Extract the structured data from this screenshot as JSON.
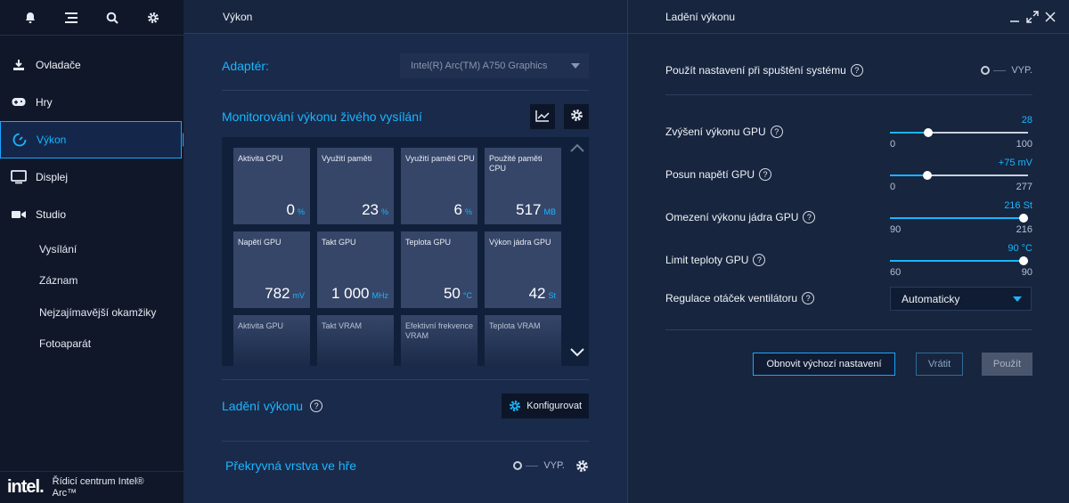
{
  "sidebar": {
    "top_icons": [
      "bell-icon",
      "menu-icon",
      "search-icon",
      "gear-icon"
    ],
    "items": [
      {
        "label": "Ovladače",
        "icon": "download-icon"
      },
      {
        "label": "Hry",
        "icon": "gamepad-icon"
      },
      {
        "label": "Výkon",
        "icon": "gauge-icon",
        "active": true
      },
      {
        "label": "Displej",
        "icon": "monitor-icon"
      },
      {
        "label": "Studio",
        "icon": "camera-icon"
      }
    ],
    "sub_items": [
      "Vysílání",
      "Záznam",
      "Nejzajímavější okamžiky",
      "Fotoaparát"
    ],
    "brand": {
      "logo": "intel.",
      "name": "Řídicí centrum Intel® Arc™"
    }
  },
  "mid": {
    "title": "Výkon",
    "adapter_label": "Adaptér:",
    "adapter_value": "Intel(R) Arc(TM) A750 Graphics",
    "monitor_title": "Monitorování výkonu živého vysílání",
    "tiles": [
      {
        "label": "Aktivita CPU",
        "value": "0",
        "unit": "%"
      },
      {
        "label": "Využití paměti",
        "value": "23",
        "unit": "%"
      },
      {
        "label": "Využití paměti CPU",
        "value": "6",
        "unit": "%"
      },
      {
        "label": "Použité paměti CPU",
        "value": "517",
        "unit": "MB"
      },
      {
        "label": "Napětí GPU",
        "value": "782",
        "unit": "mV"
      },
      {
        "label": "Takt GPU",
        "value": "1 000",
        "unit": "MHz"
      },
      {
        "label": "Teplota GPU",
        "value": "50",
        "unit": "°C"
      },
      {
        "label": "Výkon jádra GPU",
        "value": "42",
        "unit": "St"
      },
      {
        "label": "Aktivita GPU"
      },
      {
        "label": "Takt VRAM"
      },
      {
        "label": "Efektivní frekvence VRAM"
      },
      {
        "label": "Teplota VRAM"
      }
    ],
    "tuning_title": "Ladění výkonu",
    "configure_label": "Konfigurovat",
    "overlay_title": "Překryvná vrstva ve hře",
    "overlay_state": "VYP."
  },
  "right": {
    "title": "Ladění výkonu",
    "startup_label": "Použít nastavení při spuštění systému",
    "startup_state": "VYP.",
    "sliders": [
      {
        "label": "Zvýšení výkonu GPU",
        "value": "28",
        "min": "0",
        "max": "100",
        "fraction": 0.28
      },
      {
        "label": "Posun napětí GPU",
        "value": "+75 mV",
        "min": "0",
        "max": "277",
        "fraction": 0.27
      },
      {
        "label": "Omezení výkonu jádra GPU",
        "value": "216 St",
        "min": "90",
        "max": "216",
        "fraction": 1.0
      },
      {
        "label": "Limit teploty GPU",
        "value": "90 °C",
        "min": "60",
        "max": "90",
        "fraction": 1.0
      }
    ],
    "fan_label": "Regulace otáček ventilátoru",
    "fan_value": "Automaticky",
    "buttons": {
      "reset": "Obnovit výchozí nastavení",
      "undo": "Vrátit",
      "apply": "Použít"
    }
  },
  "colors": {
    "accent": "#19b6ff",
    "sidebar_bg": "#0f1729",
    "panel_bg": "#1a2a4a"
  }
}
